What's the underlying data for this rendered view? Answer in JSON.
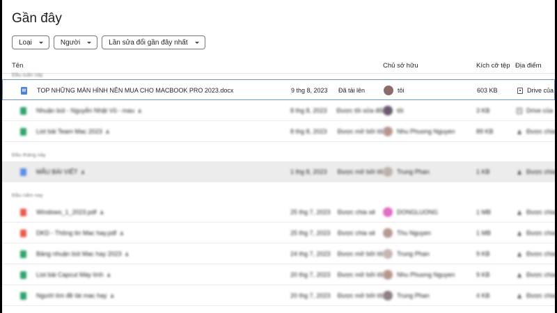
{
  "page_title": "Gần đây",
  "filters": {
    "type_label": "Loại",
    "people_label": "Người",
    "modified_label": "Lần sửa đổi gần đây nhất"
  },
  "columns": {
    "name": "Tên",
    "owner": "Chủ sở hữu",
    "size": "Kích cỡ tệp",
    "location": "Địa điểm"
  },
  "sections": {
    "earlier_this_week": "Đầu tuần này",
    "earlier_this_month": "Đầu tháng này",
    "earlier_this_year": "Đầu năm nay"
  },
  "rows": [
    {
      "icon": "word-doc-icon",
      "icon_color": "#4f81d8",
      "icon_letter": "W",
      "name": "TOP NHỮNG MÀN HÌNH NÊN MUA CHO MACBOOK PRO 2023.docx",
      "date": "9 thg 8, 2023",
      "activity": "Đã tải lên",
      "owner": "tôi",
      "avatar_color": "#8d6b6b",
      "size": "603 KB",
      "location": "Drive của",
      "location_icon": "drive-icon",
      "blurred": false,
      "selected": true
    },
    {
      "icon": "sheets-icon",
      "icon_color": "#30a46c",
      "icon_letter": "",
      "name": "Nhuận bút - Nguyễn Nhật Vũ - mau",
      "date": "8 thg 8, 2023",
      "activity": "Được tôi sửa đổi",
      "owner": "tôi",
      "avatar_color": "#6a5a70",
      "size": "3 KB",
      "location": "Drive của",
      "location_icon": "drive-icon",
      "blurred": true,
      "shared": true
    },
    {
      "icon": "sheets-icon",
      "icon_color": "#30a46c",
      "icon_letter": "",
      "name": "List bài Team Mac 2023",
      "date": "8 thg 8, 2023",
      "activity": "Được mở bởi tôi",
      "owner": "Nhu Phuong Nguyen",
      "avatar_color": "#b79890",
      "size": "89 KB",
      "location": "Được chia",
      "location_icon": "shared-icon",
      "blurred": true,
      "shared": true
    },
    {
      "section": "earlier_this_month"
    },
    {
      "icon": "docs-icon",
      "icon_color": "#5c8ee6",
      "icon_letter": "",
      "name": "MẪU BÀI VIẾT",
      "date": "1 thg 8, 2023",
      "activity": "Được mở bởi tôi",
      "owner": "Trung Phan",
      "avatar_color": "#bfb2ad",
      "size": "1 KB",
      "location": "Được chia",
      "location_icon": "shared-icon",
      "blurred": true,
      "gray": true,
      "shared": true
    },
    {
      "section": "earlier_this_year"
    },
    {
      "icon": "pdf-icon",
      "icon_color": "#ea5a4d",
      "icon_letter": "",
      "name": "Windows_1_2023.pdf",
      "date": "25 thg 7, 2023",
      "activity": "Được chia sẻ",
      "owner": "DONGLUONG",
      "avatar_color": "#e06cc3",
      "size": "1 MB",
      "location": "Được chia",
      "location_icon": "shared-icon",
      "blurred": true,
      "shared": true
    },
    {
      "icon": "pdf-icon",
      "icon_color": "#ea5a4d",
      "icon_letter": "",
      "name": "DKD - Thông tin Mac hay.pdf",
      "date": "25 thg 7, 2023",
      "activity": "Được chia sẻ",
      "owner": "Thu Nguyen",
      "avatar_color": "#b59a94",
      "size": "1 MB",
      "location": "Được chia",
      "location_icon": "shared-icon",
      "blurred": true,
      "shared": true
    },
    {
      "icon": "sheets-icon",
      "icon_color": "#30a46c",
      "icon_letter": "",
      "name": "Bảng nhuận bút Mac hay 2023",
      "date": "24 thg 7, 2023",
      "activity": "Được mở bởi tôi",
      "owner": "Trung Phan",
      "avatar_color": "#c4b6b0",
      "size": "9 KB",
      "location": "Được chia",
      "location_icon": "shared-icon",
      "blurred": true,
      "shared": true
    },
    {
      "icon": "sheets-icon",
      "icon_color": "#30a46c",
      "icon_letter": "",
      "name": "List bài Capcut Máy tính",
      "date": "20 thg 7, 2023",
      "activity": "Được mở bởi tôi",
      "owner": "Nhu Phuong Nguyen",
      "avatar_color": "#b79890",
      "size": "9 KB",
      "location": "Được chia",
      "location_icon": "shared-icon",
      "blurred": true,
      "shared": true
    },
    {
      "icon": "sheets-icon",
      "icon_color": "#30a46c",
      "icon_letter": "",
      "name": "Người tìm đề tài mac hay",
      "date": "20 thg 7, 2023",
      "activity": "Được mở bởi tôi",
      "owner": "Trung Phan",
      "avatar_color": "#8e7f86",
      "size": "4 KB",
      "location": "Được chia",
      "location_icon": "shared-icon",
      "blurred": true,
      "shared": true
    }
  ]
}
